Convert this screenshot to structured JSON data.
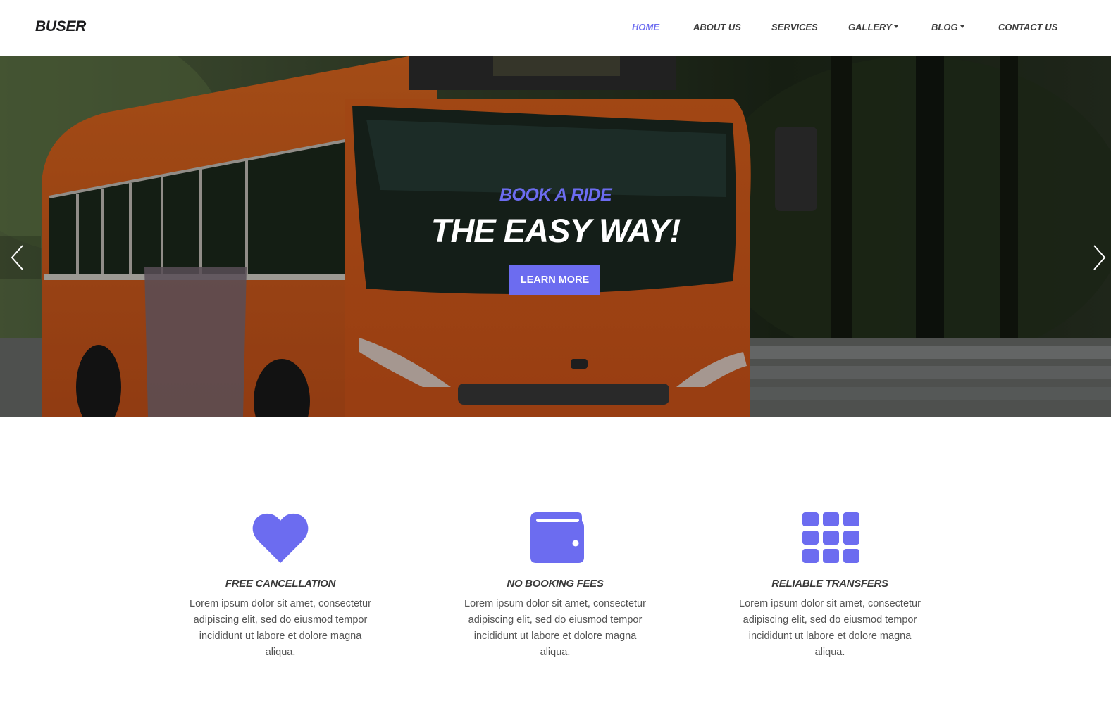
{
  "brand": "BUSER",
  "nav": {
    "items": [
      {
        "label": "HOME",
        "active": true,
        "dropdown": false
      },
      {
        "label": "ABOUT US",
        "active": false,
        "dropdown": false
      },
      {
        "label": "SERVICES",
        "active": false,
        "dropdown": false
      },
      {
        "label": "GALLERY",
        "active": false,
        "dropdown": true
      },
      {
        "label": "BLOG",
        "active": false,
        "dropdown": true
      },
      {
        "label": "CONTACT US",
        "active": false,
        "dropdown": false
      }
    ]
  },
  "hero": {
    "kicker": "BOOK A RIDE",
    "title": "THE EASY WAY!",
    "button_label": "LEARN MORE",
    "image": "orange-double-decker-bus",
    "prev_icon": "chevron-left-icon",
    "next_icon": "chevron-right-icon"
  },
  "features": [
    {
      "icon": "heart-icon",
      "title": "FREE CANCELLATION",
      "text": "Lorem ipsum dolor sit amet, consectetur adipiscing elit, sed do eiusmod tempor incididunt ut labore et dolore magna aliqua."
    },
    {
      "icon": "wallet-icon",
      "title": "NO BOOKING FEES",
      "text": "Lorem ipsum dolor sit amet, consectetur adipiscing elit, sed do eiusmod tempor incididunt ut labore et dolore magna aliqua."
    },
    {
      "icon": "grid-icon",
      "title": "RELIABLE TRANSFERS",
      "text": "Lorem ipsum dolor sit amet, consectetur adipiscing elit, sed do eiusmod tempor incididunt ut labore et dolore magna aliqua."
    }
  ],
  "colors": {
    "accent": "#6c6cf0",
    "heading": "#3a3a3a",
    "body_text": "#555555",
    "white": "#ffffff"
  }
}
